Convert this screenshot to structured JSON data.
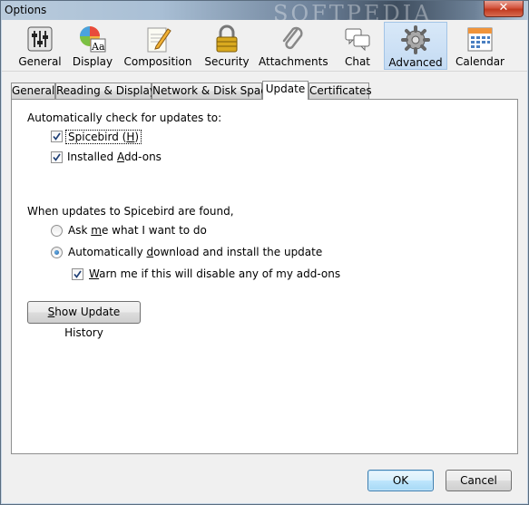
{
  "window": {
    "title": "Options",
    "close_glyph": "✕",
    "watermark": "SOFTPEDIA"
  },
  "toolbar": {
    "items": [
      {
        "label": "General",
        "icon": "sliders-icon"
      },
      {
        "label": "Display",
        "icon": "color-aa-icon"
      },
      {
        "label": "Composition",
        "icon": "pencil-paper-icon"
      },
      {
        "label": "Security",
        "icon": "padlock-icon"
      },
      {
        "label": "Attachments",
        "icon": "paperclip-icon"
      },
      {
        "label": "Chat",
        "icon": "chat-bubbles-icon"
      },
      {
        "label": "Advanced",
        "icon": "gear-icon",
        "selected": true
      },
      {
        "label": "Calendar",
        "icon": "calendar-icon"
      }
    ]
  },
  "tabs": [
    {
      "label": "General"
    },
    {
      "label": "Reading & Display"
    },
    {
      "label": "Network & Disk Space"
    },
    {
      "label": "Update",
      "active": true
    },
    {
      "label": "Certificates"
    }
  ],
  "update": {
    "auto_check_heading": "Automatically check for updates to:",
    "spicebird_label_pre": "Spicebird (",
    "spicebird_label_key": "H",
    "spicebird_label_post": ")",
    "spicebird_checked": true,
    "addons_label_pre": "Installed ",
    "addons_label_key": "A",
    "addons_label_post": "dd-ons",
    "addons_checked": true,
    "found_heading": "When updates to Spicebird are found,",
    "ask_label_pre": "Ask ",
    "ask_label_key": "m",
    "ask_label_post": "e what I want to do",
    "auto_label_pre": "Automatically ",
    "auto_label_key": "d",
    "auto_label_post": "ownload and install the update",
    "auto_selected": true,
    "warn_label_key": "W",
    "warn_label_post": "arn me if this will disable any of my add-ons",
    "warn_checked": true,
    "history_button_key": "S",
    "history_button_post": "how Update History"
  },
  "footer": {
    "ok_label": "OK",
    "cancel_label": "Cancel"
  }
}
